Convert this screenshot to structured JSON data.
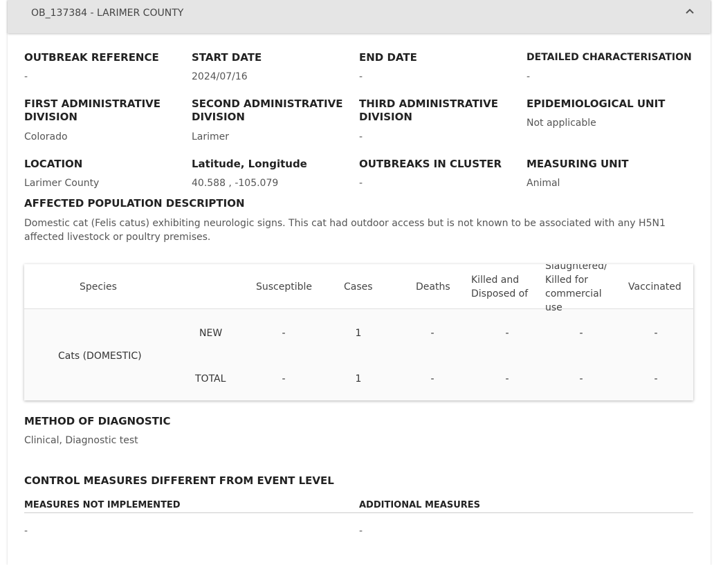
{
  "header": {
    "title": "OB_137384 - LARIMER COUNTY",
    "collapse_icon": "chevron-up-icon"
  },
  "fields": {
    "outbreak_reference": {
      "label": "OUTBREAK REFERENCE",
      "value": "-"
    },
    "start_date": {
      "label": "START DATE",
      "value": "2024/07/16"
    },
    "end_date": {
      "label": "END DATE",
      "value": "-"
    },
    "detailed_characterisation": {
      "label": "DETAILED CHARACTERISATION",
      "value": "-"
    },
    "first_admin_division": {
      "label_line1": "FIRST ADMINISTRATIVE",
      "label_line2": "DIVISION",
      "value": "Colorado"
    },
    "second_admin_division": {
      "label_line1": "SECOND ADMINISTRATIVE",
      "label_line2": "DIVISION",
      "value": "Larimer"
    },
    "third_admin_division": {
      "label_line1": "THIRD ADMINISTRATIVE",
      "label_line2": "DIVISION",
      "value": "-"
    },
    "epidemiological_unit": {
      "label": "EPIDEMIOLOGICAL UNIT",
      "value": "Not applicable"
    },
    "location": {
      "label": "LOCATION",
      "value": "Larimer County"
    },
    "lat_long": {
      "label": "Latitude, Longitude",
      "value": "40.588 , -105.079"
    },
    "outbreaks_in_cluster": {
      "label": "OUTBREAKS IN CLUSTER",
      "value": "-"
    },
    "measuring_unit": {
      "label": "MEASURING UNIT",
      "value": "Animal"
    }
  },
  "affected_population": {
    "label": "AFFECTED POPULATION DESCRIPTION",
    "text": "Domestic cat (Felis catus) exhibiting neurologic signs. This cat had outdoor access but is not known to be associated with any H5N1 affected livestock or poultry premises."
  },
  "table": {
    "headers": {
      "species": "Species",
      "susceptible": "Susceptible",
      "cases": "Cases",
      "deaths": "Deaths",
      "killed_disposed_line1": "Killed and",
      "killed_disposed_line2": "Disposed of",
      "slaughtered_line0": "Slaughtered/",
      "slaughtered_line1": "Killed for",
      "slaughtered_line2": "commercial",
      "slaughtered_line3": "use",
      "vaccinated": "Vaccinated"
    },
    "species_name": "Cats (DOMESTIC)",
    "rows": [
      {
        "type": "NEW",
        "susceptible": "-",
        "cases": "1",
        "deaths": "-",
        "killed": "-",
        "slaughtered": "-",
        "vaccinated": "-"
      },
      {
        "type": "TOTAL",
        "susceptible": "-",
        "cases": "1",
        "deaths": "-",
        "killed": "-",
        "slaughtered": "-",
        "vaccinated": "-"
      }
    ]
  },
  "diagnostic": {
    "label": "METHOD OF DIAGNOSTIC",
    "value": "Clinical, Diagnostic test"
  },
  "control_measures": {
    "label": "CONTROL MEASURES DIFFERENT FROM EVENT LEVEL",
    "not_implemented_label": "MEASURES NOT IMPLEMENTED",
    "not_implemented_value": "-",
    "additional_label": "ADDITIONAL MEASURES",
    "additional_value": "-"
  }
}
